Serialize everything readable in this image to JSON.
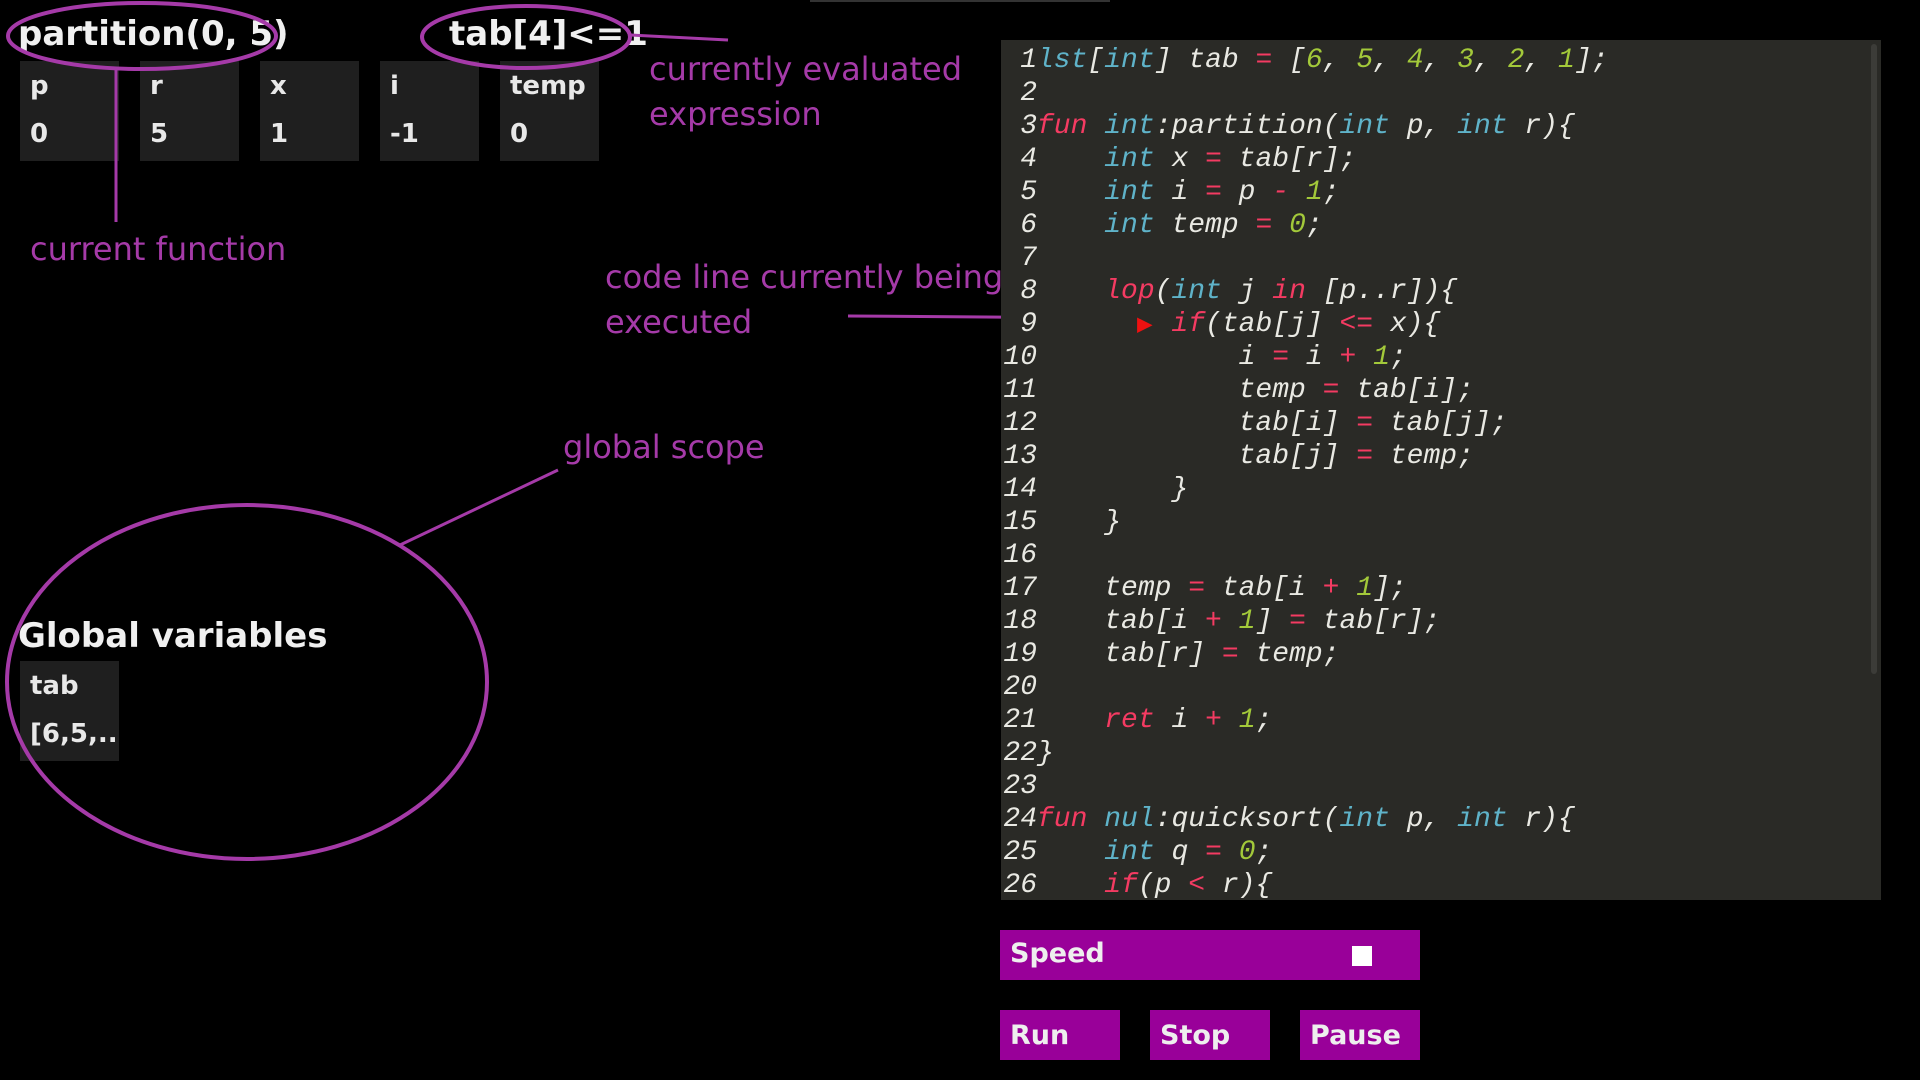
{
  "header": {
    "function_call": "partition(0, 5)",
    "current_expression": "tab[4]<=1"
  },
  "local_variables": [
    {
      "name": "p",
      "value": "0"
    },
    {
      "name": "r",
      "value": "5"
    },
    {
      "name": "x",
      "value": "1"
    },
    {
      "name": "i",
      "value": "-1"
    },
    {
      "name": "temp",
      "value": "0"
    }
  ],
  "globals": {
    "title": "Global variables",
    "variables": [
      {
        "name": "tab",
        "value": "[6,5,.."
      }
    ]
  },
  "annotations": {
    "current_function": "current function",
    "currently_evaluated_expression_1": "currently evaluated",
    "currently_evaluated_expression_2": "expression",
    "code_line_1": "code line currently being",
    "code_line_2": "executed",
    "global_scope": "global scope"
  },
  "editor": {
    "current_line": 9,
    "lines": [
      {
        "n": "1",
        "text": "lst[int] tab = [6, 5, 4, 3, 2, 1];"
      },
      {
        "n": "2",
        "text": ""
      },
      {
        "n": "3",
        "text": "fun int:partition(int p, int r){"
      },
      {
        "n": "4",
        "text": "    int x = tab[r];"
      },
      {
        "n": "5",
        "text": "    int i = p - 1;"
      },
      {
        "n": "6",
        "text": "    int temp = 0;"
      },
      {
        "n": "7",
        "text": ""
      },
      {
        "n": "8",
        "text": "    lop(int j in [p..r]){"
      },
      {
        "n": "9",
        "text": "        if(tab[j] <= x){"
      },
      {
        "n": "10",
        "text": "            i = i + 1;"
      },
      {
        "n": "11",
        "text": "            temp = tab[i];"
      },
      {
        "n": "12",
        "text": "            tab[i] = tab[j];"
      },
      {
        "n": "13",
        "text": "            tab[j] = temp;"
      },
      {
        "n": "14",
        "text": "        }"
      },
      {
        "n": "15",
        "text": "    }"
      },
      {
        "n": "16",
        "text": ""
      },
      {
        "n": "17",
        "text": "    temp = tab[i + 1];"
      },
      {
        "n": "18",
        "text": "    tab[i + 1] = tab[r];"
      },
      {
        "n": "19",
        "text": "    tab[r] = temp;"
      },
      {
        "n": "20",
        "text": ""
      },
      {
        "n": "21",
        "text": "    ret i + 1;"
      },
      {
        "n": "22",
        "text": "}"
      },
      {
        "n": "23",
        "text": ""
      },
      {
        "n": "24",
        "text": "fun nul:quicksort(int p, int r){"
      },
      {
        "n": "25",
        "text": "    int q = 0;"
      },
      {
        "n": "26",
        "text": "    if(p < r){"
      }
    ]
  },
  "controls": {
    "speed_label": "Speed",
    "run_label": "Run",
    "stop_label": "Stop",
    "pause_label": "Pause"
  },
  "colors": {
    "annotation": "#a53aa8",
    "control_bg": "#990099",
    "keyword": "#f43b62",
    "type": "#5fb3c9",
    "number": "#a3c93a",
    "arrow": "#ee1111"
  }
}
